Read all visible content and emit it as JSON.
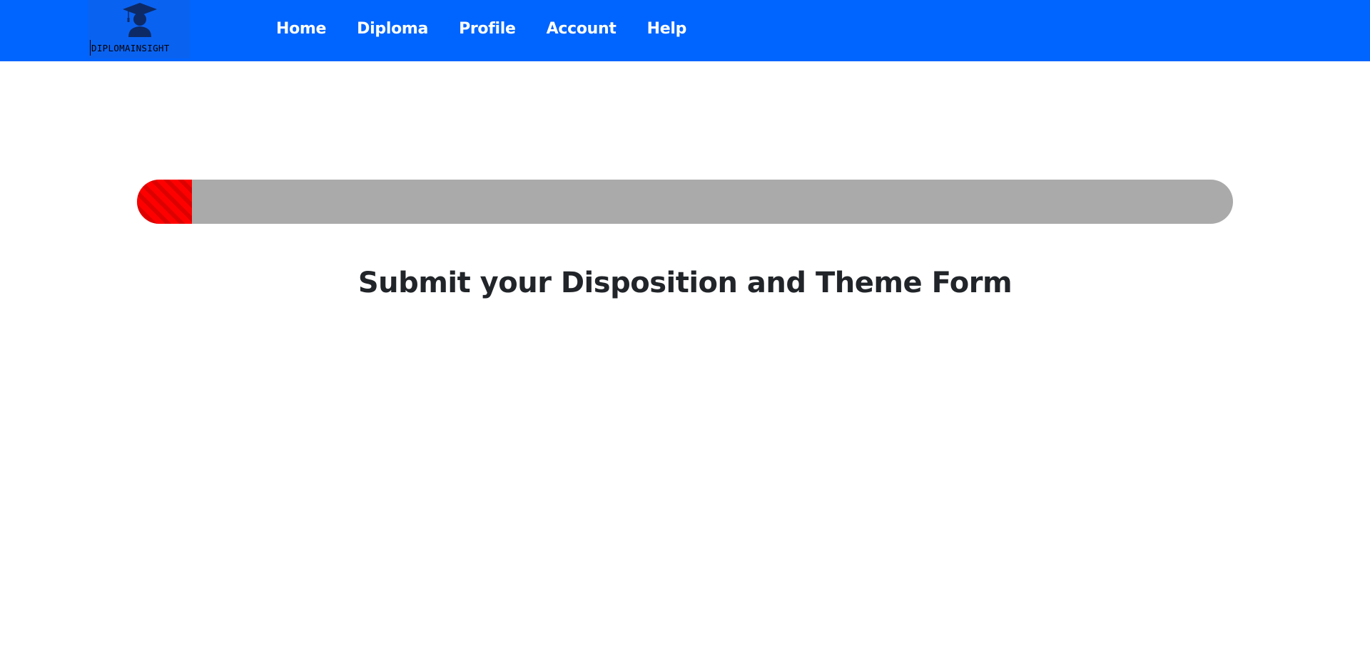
{
  "header": {
    "brand": "DIPLOMAINSIGHT",
    "logo_icon": "graduate-cap-icon",
    "background_color": "#0064ff",
    "nav_items": [
      {
        "label": "Home"
      },
      {
        "label": "Diploma"
      },
      {
        "label": "Profile"
      },
      {
        "label": "Account"
      },
      {
        "label": "Help"
      }
    ]
  },
  "progress": {
    "value_fraction": 0.05,
    "fill_color": "#ff0000",
    "track_color": "#aaaaaa"
  },
  "main": {
    "title": "Submit your Disposition and Theme Form"
  }
}
